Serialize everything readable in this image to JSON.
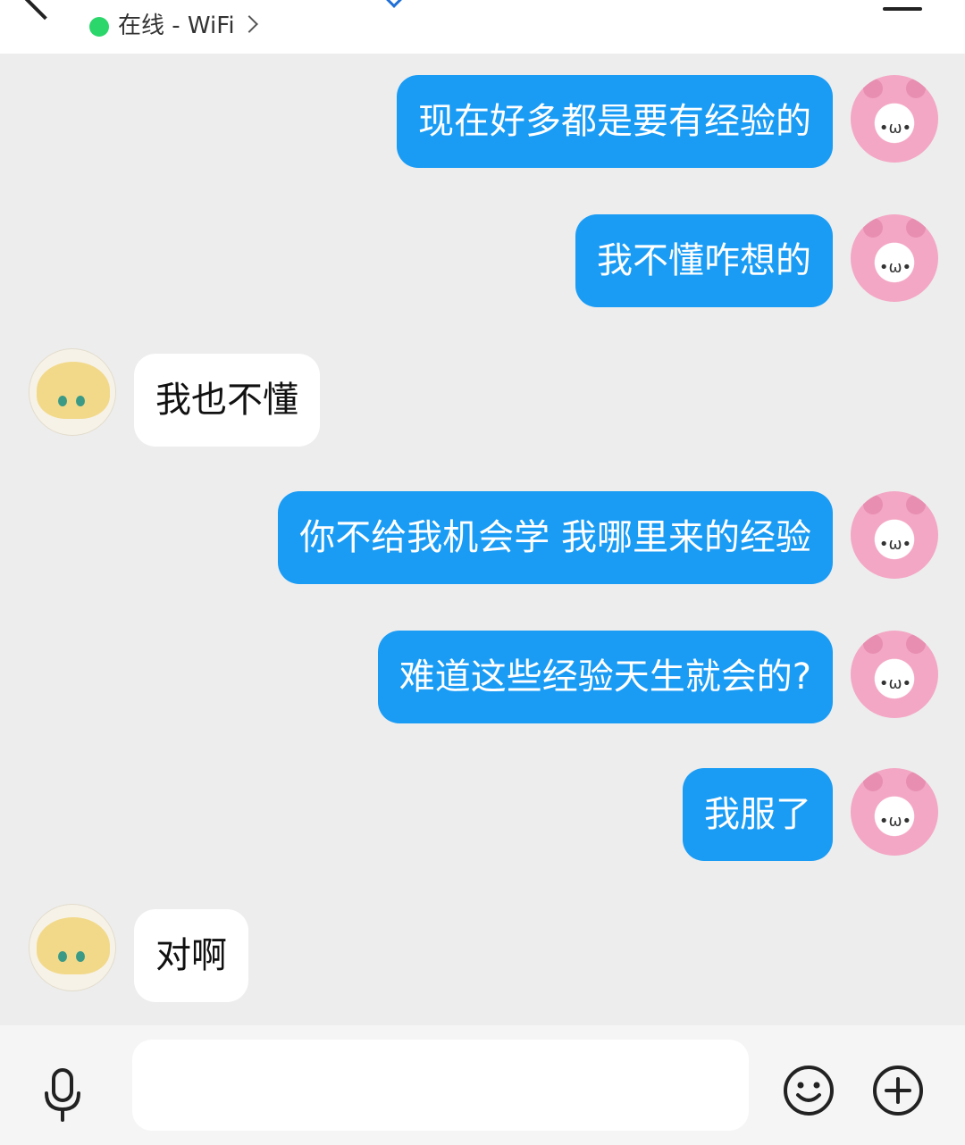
{
  "header": {
    "status_text": "在线 - WiFi",
    "status_color": "#2bd66b"
  },
  "colors": {
    "outgoing_bubble": "#1a9cf5",
    "incoming_bubble": "#ffffff",
    "chat_background": "#ededed"
  },
  "avatars": {
    "me": {
      "icon": "pink-bear-avatar",
      "face": "•ω•"
    },
    "other": {
      "icon": "blond-anime-avatar"
    }
  },
  "messages": [
    {
      "sender": "me",
      "text": "现在好多都是要有经验的"
    },
    {
      "sender": "me",
      "text": "我不懂咋想的"
    },
    {
      "sender": "other",
      "text": "我也不懂"
    },
    {
      "sender": "me",
      "text": "你不给我机会学 我哪里来的经验"
    },
    {
      "sender": "me",
      "text": "难道这些经验天生就会的?"
    },
    {
      "sender": "me",
      "text": "我服了"
    },
    {
      "sender": "other",
      "text": "对啊"
    }
  ],
  "input": {
    "value": "",
    "placeholder": "",
    "voice_icon": "microphone-icon",
    "emoji_icon": "smiley-icon",
    "more_icon": "plus-circle-icon"
  }
}
